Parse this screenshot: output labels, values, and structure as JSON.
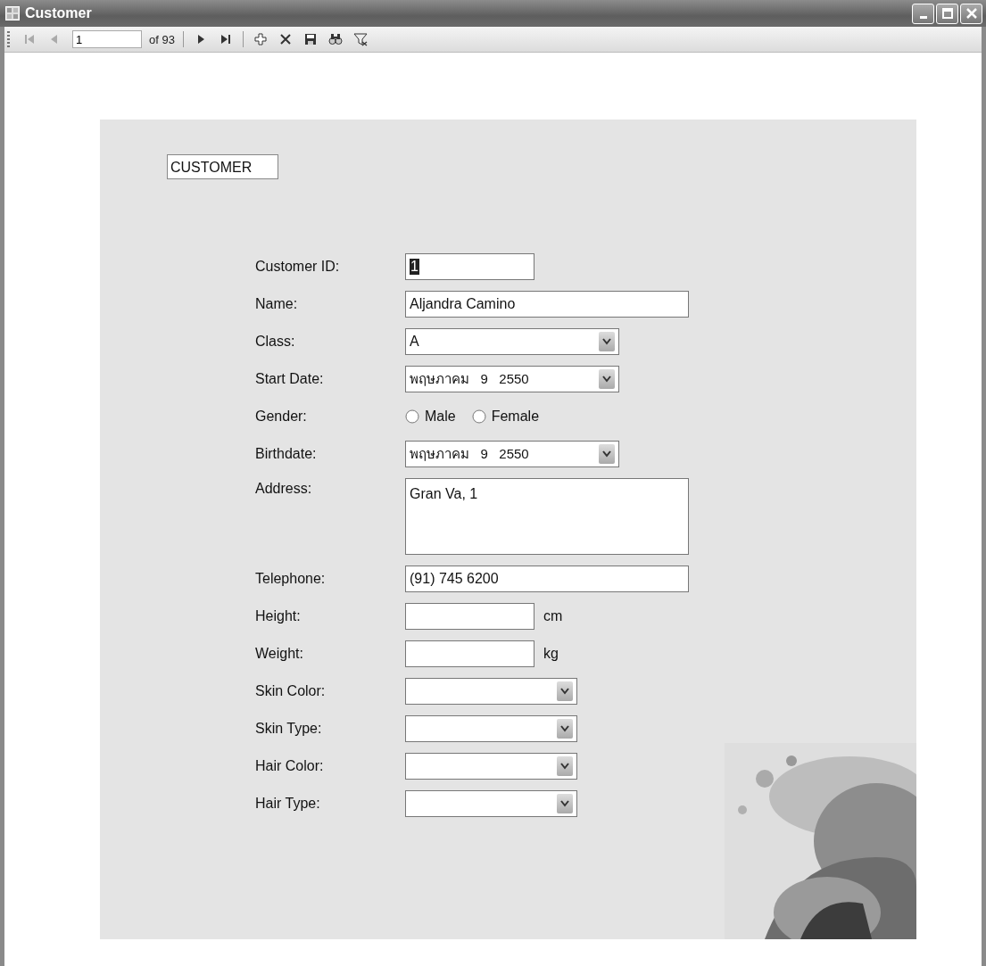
{
  "window": {
    "title": "Customer"
  },
  "toolbar": {
    "items": [
      {
        "kind": "first",
        "disabled": true
      },
      {
        "kind": "previous",
        "disabled": true
      },
      {
        "kind": "position",
        "value": "1"
      },
      {
        "kind": "count",
        "text": "of 93"
      },
      {
        "kind": "separator"
      },
      {
        "kind": "next",
        "disabled": false
      },
      {
        "kind": "last",
        "disabled": false
      },
      {
        "kind": "separator"
      },
      {
        "kind": "add"
      },
      {
        "kind": "delete"
      },
      {
        "kind": "save"
      },
      {
        "kind": "find"
      },
      {
        "kind": "filter"
      }
    ]
  },
  "form": {
    "heading": "CUSTOMER",
    "fields": [
      {
        "kind": "short-text",
        "label": "Customer ID:",
        "value": "1",
        "text_selected": true
      },
      {
        "kind": "text",
        "label": "Name:",
        "value": "Aljandra Camino"
      },
      {
        "kind": "combo",
        "label": "Class:",
        "value": "A"
      },
      {
        "kind": "date",
        "label": "Start Date:",
        "value": "พฤษภาคม   9   2550"
      },
      {
        "kind": "radio",
        "label": "Gender:",
        "options": [
          {
            "label": "Male",
            "selected": false
          },
          {
            "label": "Female",
            "selected": false
          }
        ]
      },
      {
        "kind": "date",
        "label": "Birthdate:",
        "value": "พฤษภาคม   9   2550"
      },
      {
        "kind": "memo",
        "label": "Address:",
        "value": "Gran Va, 1"
      },
      {
        "kind": "text",
        "label": "Telephone:",
        "value": "(91) 745 6200"
      },
      {
        "kind": "unit-text",
        "label": "Height:",
        "unit": "cm"
      },
      {
        "kind": "unit-text",
        "label": "Weight:",
        "unit": "kg"
      },
      {
        "kind": "small-combo",
        "label": "Skin Color:"
      },
      {
        "kind": "small-combo",
        "label": "Skin Type:"
      },
      {
        "kind": "small-combo",
        "label": "Hair Color:"
      },
      {
        "kind": "small-combo",
        "label": "Hair Type:"
      }
    ]
  }
}
